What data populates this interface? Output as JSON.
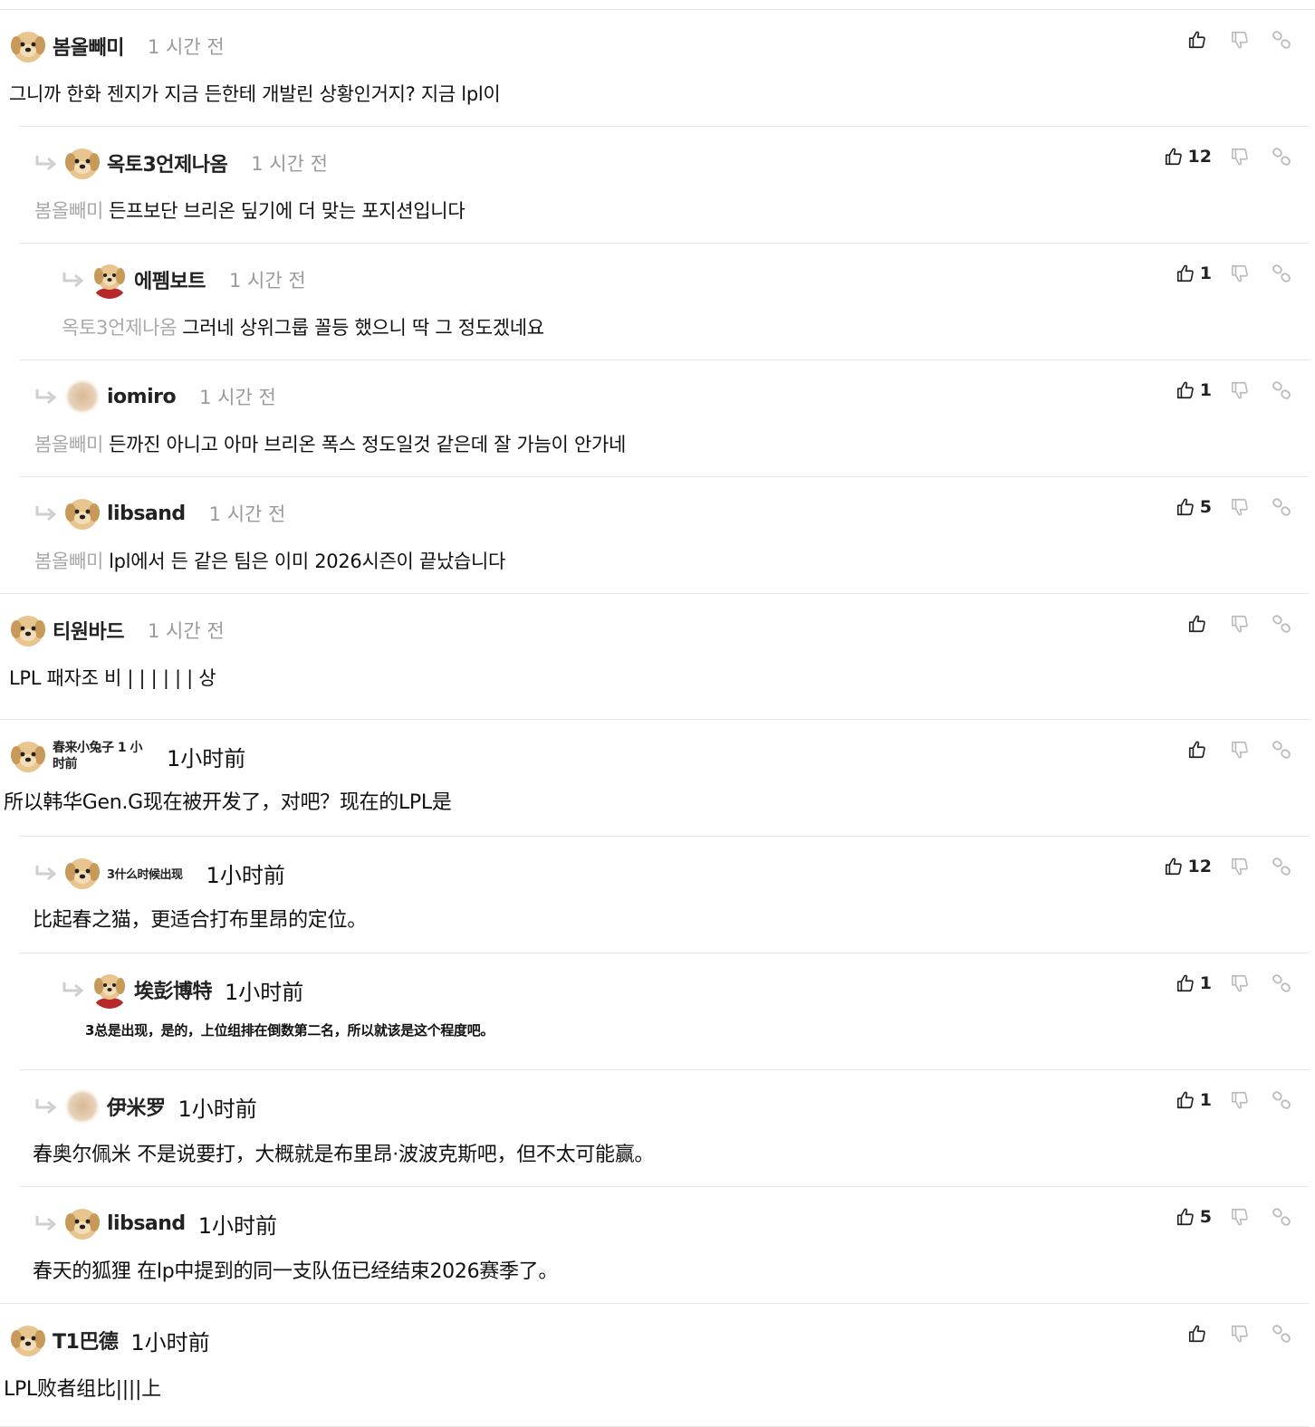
{
  "comments": [
    {
      "level": 0,
      "avatar": "dog",
      "name": "봄올빼미",
      "time": "1 시간 전",
      "mention": "",
      "text": "그니까 한화 젠지가 지금 든한테 개발린 상황인거지? 지금 lpl이",
      "likes": ""
    },
    {
      "level": 1,
      "avatar": "dog",
      "name": "옥토3언제나옴",
      "time": "1 시간 전",
      "mention": "봄올빼미",
      "text": "든프보단 브리온 딮기에 더 맞는 포지션입니다",
      "likes": "12"
    },
    {
      "level": 2,
      "avatar": "dog-red",
      "name": "에펨보트",
      "time": "1 시간 전",
      "mention": "옥토3언제나옴",
      "text": "그러네 상위그룹 꼴등 했으니 딱 그 정도겠네요",
      "likes": "1"
    },
    {
      "level": 1,
      "avatar": "blur",
      "name": "iomiro",
      "time": "1 시간 전",
      "mention": "봄올빼미",
      "text": "든까진 아니고 아마 브리온 폭스 정도일것 같은데 잘 가늠이 안가네",
      "likes": "1"
    },
    {
      "level": 1,
      "avatar": "dog",
      "name": "libsand",
      "time": "1 시간 전",
      "mention": "봄올빼미",
      "text": "lpl에서 든 같은 팀은 이미 2026시즌이 끝났습니다",
      "likes": "5"
    },
    {
      "level": 0,
      "avatar": "dog",
      "name": "티원바드",
      "time": "1 시간 전",
      "mention": "",
      "text": "LPL 패자조 비 | | | | | | 상",
      "likes": ""
    },
    {
      "level": 0,
      "avatar": "dog",
      "name": "春来小兔子 1 小时前",
      "time": "1小时前",
      "mention": "",
      "text": "所以韩华Gen.G现在被开发了，对吧？现在的LPL是",
      "likes": ""
    },
    {
      "level": 1,
      "avatar": "dog",
      "name": "3什么时候出现",
      "time": "1小时前",
      "mention": "",
      "text": "比起春之猫，更适合打布里昂的定位。",
      "likes": "12"
    },
    {
      "level": 2,
      "avatar": "dog-red",
      "name": "埃彭博特",
      "time": "1小时前",
      "mention": "",
      "text": "3总是出现，是的，上位组排在倒数第二名，所以就该是这个程度吧。",
      "likes": "1"
    },
    {
      "level": 1,
      "avatar": "blur",
      "name": "伊米罗",
      "time": "1小时前",
      "mention": "",
      "text": "春奥尔佩米 不是说要打，大概就是布里昂·波波克斯吧，但不太可能赢。",
      "likes": "1"
    },
    {
      "level": 1,
      "avatar": "dog",
      "name": "libsand",
      "time": "1小时前",
      "mention": "",
      "text": "春天的狐狸 在lp中提到的同一支队伍已经结束2026赛季了。",
      "likes": "5"
    },
    {
      "level": 0,
      "avatar": "dog",
      "name": "T1巴德",
      "time": "1小时前",
      "mention": "",
      "text": "LPL败者组比||||上",
      "likes": ""
    }
  ]
}
